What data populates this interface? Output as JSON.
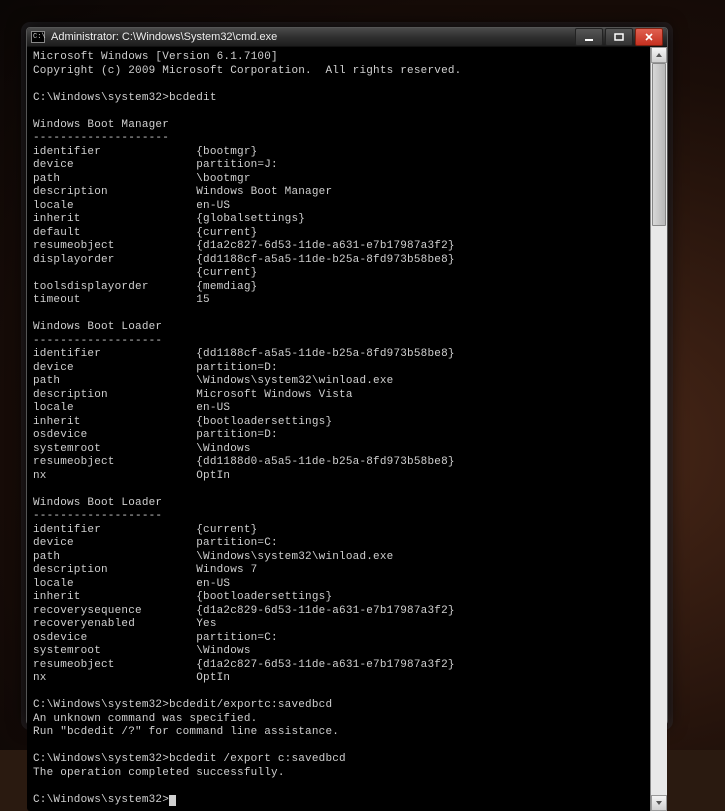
{
  "window": {
    "title": "Administrator: C:\\Windows\\System32\\cmd.exe",
    "icon_label": "C:\\"
  },
  "banner": {
    "line1": "Microsoft Windows [Version 6.1.7100]",
    "line2": "Copyright (c) 2009 Microsoft Corporation.  All rights reserved."
  },
  "prompts": {
    "p1": "C:\\Windows\\system32>bcdedit",
    "p2": "C:\\Windows\\system32>bcdedit/exportc:savedbcd",
    "p2_r1": "An unknown command was specified.",
    "p2_r2": "Run \"bcdedit /?\" for command line assistance.",
    "p3": "C:\\Windows\\system32>bcdedit /export c:savedbcd",
    "p3_r1": "The operation completed successfully.",
    "p4": "C:\\Windows\\system32>"
  },
  "sections": [
    {
      "title": "Windows Boot Manager",
      "underline": "--------------------",
      "rows": [
        [
          "identifier",
          "{bootmgr}"
        ],
        [
          "device",
          "partition=J:"
        ],
        [
          "path",
          "\\bootmgr"
        ],
        [
          "description",
          "Windows Boot Manager"
        ],
        [
          "locale",
          "en-US"
        ],
        [
          "inherit",
          "{globalsettings}"
        ],
        [
          "default",
          "{current}"
        ],
        [
          "resumeobject",
          "{d1a2c827-6d53-11de-a631-e7b17987a3f2}"
        ],
        [
          "displayorder",
          "{dd1188cf-a5a5-11de-b25a-8fd973b58be8}"
        ],
        [
          "",
          "{current}"
        ],
        [
          "toolsdisplayorder",
          "{memdiag}"
        ],
        [
          "timeout",
          "15"
        ]
      ]
    },
    {
      "title": "Windows Boot Loader",
      "underline": "-------------------",
      "rows": [
        [
          "identifier",
          "{dd1188cf-a5a5-11de-b25a-8fd973b58be8}"
        ],
        [
          "device",
          "partition=D:"
        ],
        [
          "path",
          "\\Windows\\system32\\winload.exe"
        ],
        [
          "description",
          "Microsoft Windows Vista"
        ],
        [
          "locale",
          "en-US"
        ],
        [
          "inherit",
          "{bootloadersettings}"
        ],
        [
          "osdevice",
          "partition=D:"
        ],
        [
          "systemroot",
          "\\Windows"
        ],
        [
          "resumeobject",
          "{dd1188d0-a5a5-11de-b25a-8fd973b58be8}"
        ],
        [
          "nx",
          "OptIn"
        ]
      ]
    },
    {
      "title": "Windows Boot Loader",
      "underline": "-------------------",
      "rows": [
        [
          "identifier",
          "{current}"
        ],
        [
          "device",
          "partition=C:"
        ],
        [
          "path",
          "\\Windows\\system32\\winload.exe"
        ],
        [
          "description",
          "Windows 7"
        ],
        [
          "locale",
          "en-US"
        ],
        [
          "inherit",
          "{bootloadersettings}"
        ],
        [
          "recoverysequence",
          "{d1a2c829-6d53-11de-a631-e7b17987a3f2}"
        ],
        [
          "recoveryenabled",
          "Yes"
        ],
        [
          "osdevice",
          "partition=C:"
        ],
        [
          "systemroot",
          "\\Windows"
        ],
        [
          "resumeobject",
          "{d1a2c827-6d53-11de-a631-e7b17987a3f2}"
        ],
        [
          "nx",
          "OptIn"
        ]
      ]
    }
  ]
}
